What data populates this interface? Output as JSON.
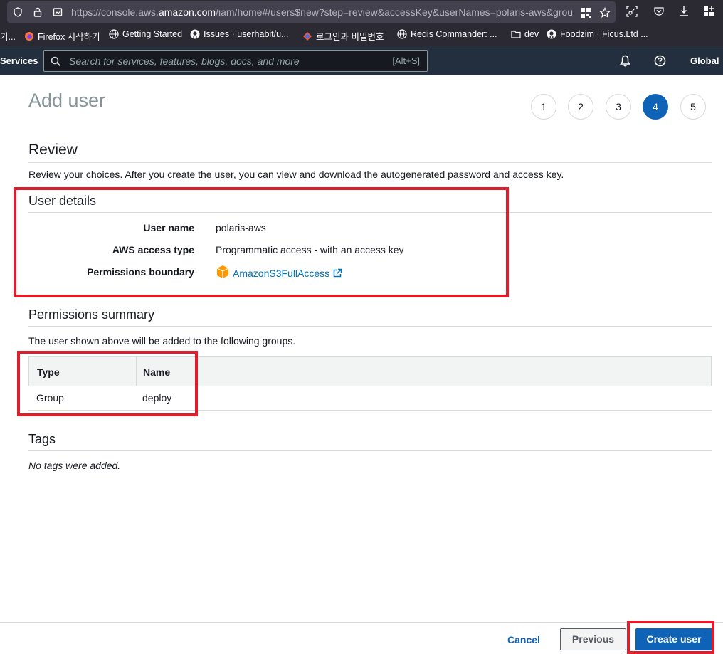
{
  "browser": {
    "url_prefix": "https://console.aws.",
    "url_domain": "amazon.com",
    "url_suffix": "/iam/home#/users$new?step=review&accessKey&userNames=polaris-aws&grou",
    "bookmarks": [
      {
        "label": "기...",
        "icon": "truncated-bookmark"
      },
      {
        "label": "Firefox 시작하기",
        "icon": "firefox-icon"
      },
      {
        "label": "Getting Started",
        "icon": "globe-icon"
      },
      {
        "label": "Issues · userhabit/u...",
        "icon": "github-icon"
      },
      {
        "label": "로그인과 비밀번호",
        "icon": "diamond-icon"
      },
      {
        "label": "Redis Commander: ...",
        "icon": "globe-icon"
      },
      {
        "label": "dev",
        "icon": "folder-icon"
      },
      {
        "label": "Foodzim · Ficus.Ltd ...",
        "icon": "github-icon"
      }
    ]
  },
  "aws_nav": {
    "services_label": "Services",
    "search_placeholder": "Search for services, features, blogs, docs, and more",
    "search_shortcut": "[Alt+S]",
    "region_label": "Global"
  },
  "wizard": {
    "title": "Add user",
    "steps": [
      "1",
      "2",
      "3",
      "4",
      "5"
    ],
    "active_step": "4"
  },
  "review": {
    "heading": "Review",
    "description": "Review your choices. After you create the user, you can view and download the autogenerated password and access key."
  },
  "user_details": {
    "heading": "User details",
    "rows": [
      {
        "label": "User name",
        "value": "polaris-aws"
      },
      {
        "label": "AWS access type",
        "value": "Programmatic access - with an access key"
      },
      {
        "label": "Permissions boundary",
        "value": "AmazonS3FullAccess"
      }
    ]
  },
  "permissions_summary": {
    "heading": "Permissions summary",
    "description": "The user shown above will be added to the following groups.",
    "columns": [
      "Type",
      "Name"
    ],
    "rows": [
      {
        "type": "Group",
        "name": "deploy"
      }
    ]
  },
  "tags": {
    "heading": "Tags",
    "empty_text": "No tags were added."
  },
  "footer": {
    "cancel_label": "Cancel",
    "previous_label": "Previous",
    "create_label": "Create user"
  },
  "colors": {
    "aws_nav_bg": "#232f3e",
    "primary_blue": "#0f63b6",
    "link_blue": "#0073bb",
    "highlight_red": "#df1d2d"
  }
}
